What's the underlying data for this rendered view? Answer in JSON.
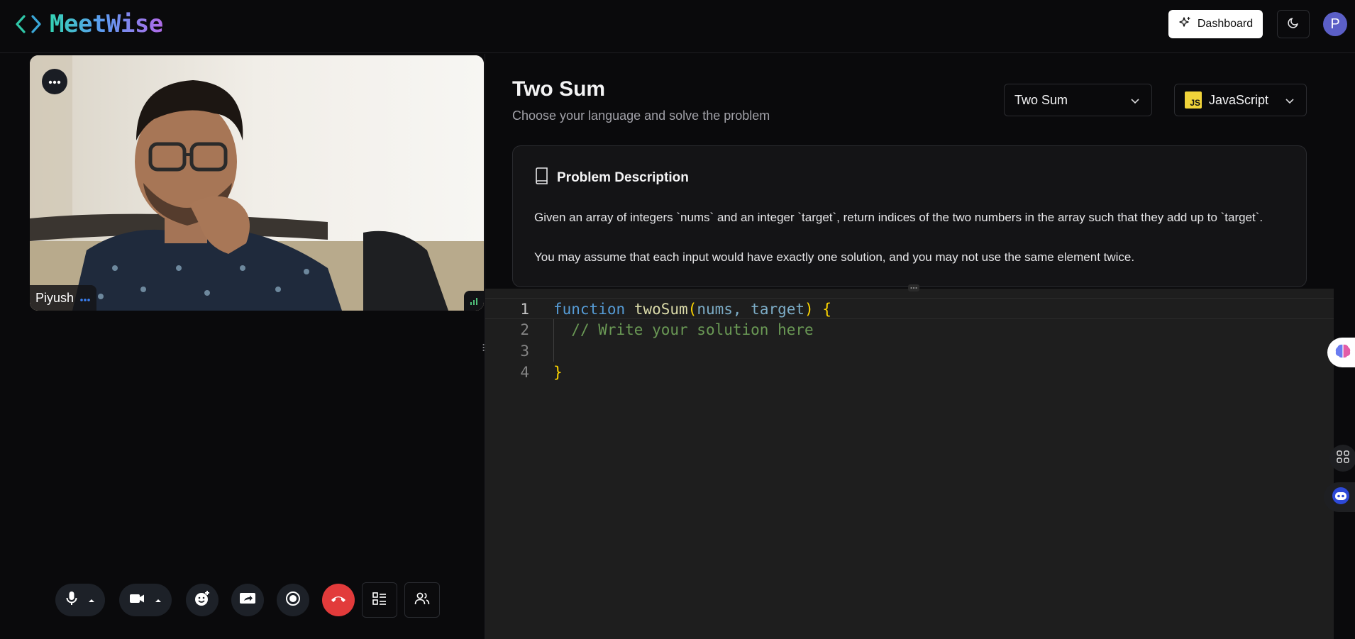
{
  "header": {
    "logo_text": "MeetWise",
    "dashboard_label": "Dashboard",
    "avatar_initial": "P"
  },
  "video": {
    "participant_name": "Piyush"
  },
  "problem": {
    "title": "Two Sum",
    "subtitle": "Choose your language and solve the problem",
    "selected_problem": "Two Sum",
    "selected_language": "JavaScript",
    "language_badge": "JS",
    "description_heading": "Problem Description",
    "paragraph_1": "Given an array of integers `nums` and an integer `target`, return indices of the two numbers in the array such that they add up to `target`.",
    "paragraph_2": "You may assume that each input would have exactly one solution, and you may not use the same element twice."
  },
  "editor": {
    "line_numbers": [
      "1",
      "2",
      "3",
      "4"
    ],
    "line1": {
      "keyword": "function",
      "name": "twoSum",
      "open_paren": "(",
      "params": "nums, target",
      "close_paren": ")",
      "open_brace": "{"
    },
    "line2_comment": "// Write your solution here",
    "line4_close": "}"
  },
  "icons": {
    "logo": "code-brackets-icon",
    "dashboard": "sparkles-icon",
    "theme": "moon-icon",
    "video_menu": "more-horizontal-icon",
    "mic": "microphone-icon",
    "camera": "video-camera-icon",
    "reactions": "emoji-add-icon",
    "share": "screen-share-icon",
    "record": "record-icon",
    "leave": "phone-end-icon",
    "layout": "layout-list-icon",
    "people": "participants-icon"
  },
  "colors": {
    "end_call": "#e23b3b",
    "avatar": "#5b5fc7",
    "js_badge": "#f1d43a"
  }
}
